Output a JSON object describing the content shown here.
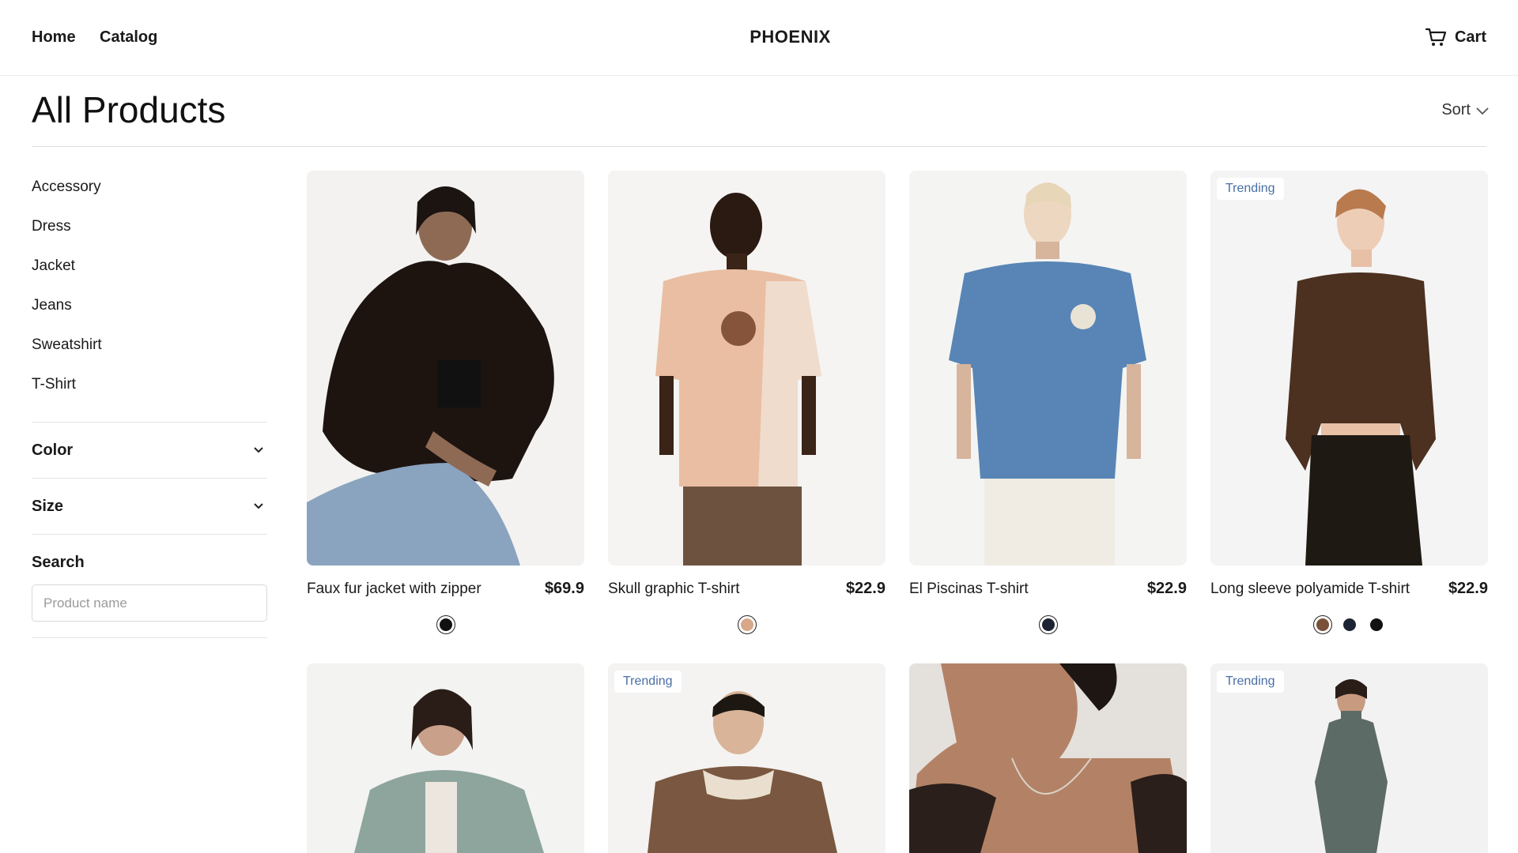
{
  "header": {
    "nav": [
      "Home",
      "Catalog"
    ],
    "brand": "PHOENIX",
    "cart_label": "Cart"
  },
  "page": {
    "title": "All Products",
    "sort_label": "Sort"
  },
  "sidebar": {
    "categories": [
      "Accessory",
      "Dress",
      "Jacket",
      "Jeans",
      "Sweatshirt",
      "T-Shirt"
    ],
    "filters": [
      "Color",
      "Size"
    ],
    "search_label": "Search",
    "search_placeholder": "Product name"
  },
  "products": [
    {
      "name": "Faux fur jacket with zipper",
      "price": "$69.9",
      "badge": "",
      "swatches": [
        "#111111"
      ]
    },
    {
      "name": "Skull graphic T-shirt",
      "price": "$22.9",
      "badge": "",
      "swatches": [
        "#d8a888"
      ]
    },
    {
      "name": "El Piscinas T-shirt",
      "price": "$22.9",
      "badge": "",
      "swatches": [
        "#1c2333"
      ]
    },
    {
      "name": "Long sleeve polyamide T-shirt",
      "price": "$22.9",
      "badge": "Trending",
      "swatches": [
        "#7a5038",
        "#1c2333",
        "#111111"
      ]
    },
    {
      "badge": ""
    },
    {
      "badge": "Trending"
    },
    {
      "badge": ""
    },
    {
      "badge": "Trending"
    }
  ],
  "colors": {
    "badge_text": "#4a6fa5",
    "divider": "#dedede"
  },
  "icons": [
    "cart-icon",
    "chevron-down-icon"
  ]
}
